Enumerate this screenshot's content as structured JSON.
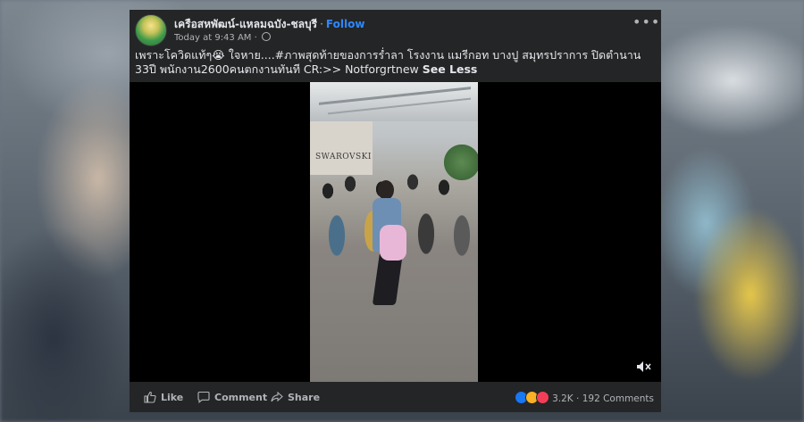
{
  "post": {
    "page_name": "เครือสหพัฒน์-แหลมฉบัง-ชลบุรี",
    "separator": "·",
    "follow_label": "Follow",
    "timestamp": "Today at 9:43 AM",
    "timestamp_sep": "·",
    "more_label": "•••",
    "caption_text": "เพราะโควิดแท้ๆ😭 ใจหาย....#ภาพสุดท้ายของการร่ำลา โรงงาน แมรีกอท บางปู สมุทรปราการ ปิดตำนาน 33ปี พนักงาน2600คนตกงานทันที CR:>> Notforgrtnew",
    "see_less_label": "See Less"
  },
  "video": {
    "store_sign": "SWAROVSKI"
  },
  "actions": {
    "like_label": "Like",
    "comment_label": "Comment",
    "share_label": "Share"
  },
  "stats": {
    "reaction_count": "3.2K",
    "comments_count": "192 Comments",
    "stat_sep": "·"
  },
  "colors": {
    "card_bg": "#242526",
    "text_primary": "#e4e6eb",
    "text_secondary": "#b0b3b8",
    "link_blue": "#2d88ff"
  },
  "icons": {
    "globe": "globe-icon",
    "more": "more-options-icon",
    "mute": "volume-mute-icon",
    "like": "thumbs-up-icon",
    "comment": "comment-bubble-icon",
    "share": "share-arrow-icon"
  }
}
